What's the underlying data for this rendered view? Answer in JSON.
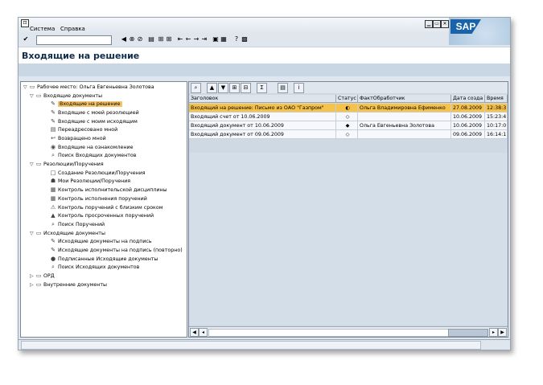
{
  "menu": {
    "system": "Система",
    "help": "Справка",
    "sys_icon": "⊡"
  },
  "window_controls": {
    "min": "▁",
    "restore": "▭",
    "close": "✕"
  },
  "logo": {
    "text": "SAP"
  },
  "toolbar": {
    "icons": [
      {
        "name": "enter-icon",
        "glyph": "✔"
      },
      {
        "name": "save-icon",
        "glyph": "◧"
      },
      {
        "name": "back-icon",
        "glyph": "◀"
      },
      {
        "name": "exit-icon",
        "glyph": "⊗"
      },
      {
        "name": "cancel-icon",
        "glyph": "⊘"
      },
      {
        "name": "print-icon",
        "glyph": "▤"
      },
      {
        "name": "find-icon",
        "glyph": "⊞"
      },
      {
        "name": "find-next-icon",
        "glyph": "⊞"
      },
      {
        "name": "first-page-icon",
        "glyph": "⇤"
      },
      {
        "name": "prev-page-icon",
        "glyph": "←"
      },
      {
        "name": "next-page-icon",
        "glyph": "→"
      },
      {
        "name": "last-page-icon",
        "glyph": "⇥"
      },
      {
        "name": "new-session-icon",
        "glyph": "▣"
      },
      {
        "name": "shortcut-icon",
        "glyph": "▦"
      },
      {
        "name": "help-icon",
        "glyph": "?"
      },
      {
        "name": "layout-icon",
        "glyph": "▩"
      }
    ]
  },
  "title": "Входящие на решение",
  "tree": {
    "root": "Рабочее место: Ольга Евгеньевна Золотова",
    "groups": [
      {
        "label": "Входящие документы",
        "items": [
          {
            "label": "Входящие на решение",
            "icon": "✎",
            "selected": true
          },
          {
            "label": "Входящие с моей резолюцией",
            "icon": "✎"
          },
          {
            "label": "Входящие с моим исходящим",
            "icon": "✎"
          },
          {
            "label": "Переадресовано мной",
            "icon": "▤"
          },
          {
            "label": "Возвращено мной",
            "icon": "↩"
          },
          {
            "label": "Входящие на ознакомление",
            "icon": "◉"
          },
          {
            "label": "Поиск Входящих документов",
            "icon": "⌕"
          }
        ]
      },
      {
        "label": "Резолюции/Поручения",
        "items": [
          {
            "label": "Создание Резолюции/Поручения",
            "icon": "□"
          },
          {
            "label": "Мои Резолюции/Поручения",
            "icon": "☗"
          },
          {
            "label": "Контроль исполнительской дисциплины",
            "icon": "▦"
          },
          {
            "label": "Контроль исполнения поручений",
            "icon": "▦"
          },
          {
            "label": "Контроль поручений с близким сроком",
            "icon": "⚠"
          },
          {
            "label": "Контроль просроченных поручений",
            "icon": "▲"
          },
          {
            "label": "Поиск Поручений",
            "icon": "⌕"
          }
        ]
      },
      {
        "label": "Исходящие документы",
        "items": [
          {
            "label": "Исходящие документы на подпись",
            "icon": "✎"
          },
          {
            "label": "Исходящие документы на подпись (повторно)",
            "icon": "✎"
          },
          {
            "label": "Подписанные Исходящие документы",
            "icon": "●"
          },
          {
            "label": "Поиск Исходящих документов",
            "icon": "⌕"
          }
        ]
      },
      {
        "label": "ОРД",
        "items": [],
        "collapsed": true
      },
      {
        "label": "Внутренние документы",
        "items": [],
        "collapsed": true
      }
    ]
  },
  "grid": {
    "toolbar_icons": [
      {
        "name": "details-icon",
        "glyph": "⌕"
      },
      {
        "name": "sort-asc-icon",
        "glyph": "▲"
      },
      {
        "name": "sort-desc-icon",
        "glyph": "▼"
      },
      {
        "name": "find-icon",
        "glyph": "⊞"
      },
      {
        "name": "filter-icon",
        "glyph": "⊟"
      },
      {
        "name": "sum-icon",
        "glyph": "Σ"
      },
      {
        "name": "export-icon",
        "glyph": "▤"
      },
      {
        "name": "info-icon",
        "glyph": "i"
      }
    ],
    "columns": [
      "Заголовок",
      "Статус",
      "ФактОбработчик",
      "Дата созда",
      "Время"
    ],
    "rows": [
      {
        "title": "Входящий на решение: Письмо из ОАО \"Газпром\"",
        "status": "◐",
        "handler": "Ольга Владимировна Ефименко",
        "date": "27.08.2009",
        "time": "12:38:3",
        "selected": true
      },
      {
        "title": "Входящий счет от 10.06.2009",
        "status": "◇",
        "handler": "",
        "date": "10.06.2009",
        "time": "15:23:4"
      },
      {
        "title": "Входящий документ от 10.06.2009",
        "status": "◆",
        "handler": "Ольга Евгеньевна Золотова",
        "date": "10.06.2009",
        "time": "10:17:0"
      },
      {
        "title": "Входящий документ от 09.06.2009",
        "status": "◇",
        "handler": "",
        "date": "09.06.2009",
        "time": "16:14:1"
      }
    ]
  },
  "scroll": {
    "left1": "◀",
    "left2": "◂",
    "right1": "▸",
    "right2": "▶"
  },
  "status": {
    "text": ""
  }
}
